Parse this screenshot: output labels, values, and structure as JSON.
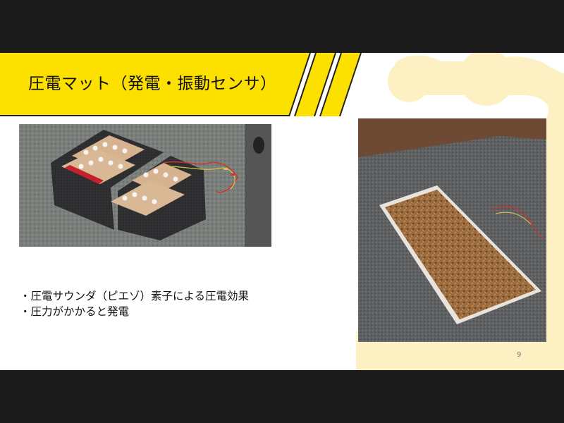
{
  "slide": {
    "title": "圧電マット（発電・振動センサ）",
    "bullets": [
      "・圧電サウンダ（ピエゾ）素子による圧電効果",
      "・圧力がかかると発電"
    ],
    "page_number": "9"
  },
  "colors": {
    "accent_yellow": "#fce000",
    "blob_cream": "#fdf0c2",
    "bar_black": "#1b1b1b"
  }
}
